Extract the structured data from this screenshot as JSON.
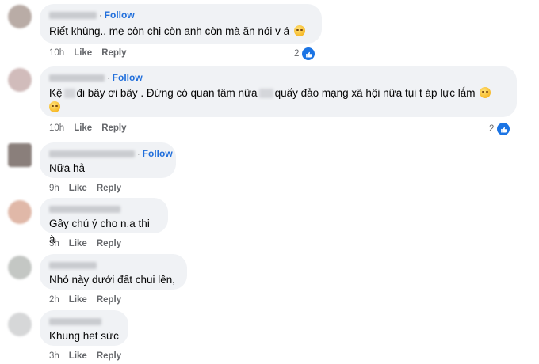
{
  "comments": [
    {
      "follow": "Follow",
      "text": "Riết khùng.. mẹ còn chị còn anh còn mà ăn nói v á",
      "time": "10h",
      "like": "Like",
      "reply": "Reply",
      "reactions": "2"
    },
    {
      "follow": "Follow",
      "text_a": "Kệ",
      "text_b": "đi bây ơi bây . Đừng có quan tâm nữa",
      "text_c": "quấy đảo mạng xã hội nữa tụi t áp lực lắm",
      "time": "10h",
      "like": "Like",
      "reply": "Reply",
      "reactions": "2"
    },
    {
      "follow": "Follow",
      "text": "Nữa hả",
      "time": "9h",
      "like": "Like",
      "reply": "Reply"
    },
    {
      "text": "Gây chú ý cho n.a thi à",
      "time": "3h",
      "like": "Like",
      "reply": "Reply"
    },
    {
      "text": "Nhỏ này dưới đất chui lên,",
      "time": "2h",
      "like": "Like",
      "reply": "Reply"
    },
    {
      "text": "Khung het sức",
      "time": "3h",
      "like": "Like",
      "reply": "Reply"
    }
  ],
  "colors": {
    "bubble": "#f0f2f5",
    "follow": "#216fdb",
    "like_icon": "#1b74e4"
  },
  "icons": {
    "reaction": "thumbs-up-icon",
    "emoji_1": "smirk-emoji-icon",
    "emoji_2": "frustrated-emoji-icon"
  }
}
